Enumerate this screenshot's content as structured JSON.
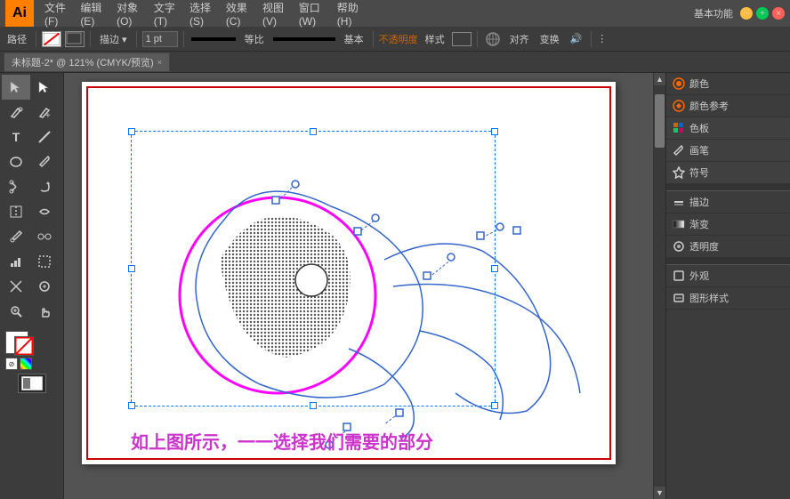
{
  "app": {
    "logo": "Ai",
    "title": "未标题-2* @ 121% (CMYK/预览)"
  },
  "menu": {
    "items": [
      "文件(F)",
      "编辑(E)",
      "对象(O)",
      "文字(T)",
      "选择(S)",
      "效果(C)",
      "视图(V)",
      "窗口(W)",
      "帮助(H)"
    ]
  },
  "toolbar": {
    "path_label": "路径",
    "stroke_label": "描边",
    "stroke_size": "1 pt",
    "equal_label": "等比",
    "basic_label": "基本",
    "opacity_label": "不透明度",
    "style_label": "样式",
    "align_label": "对齐",
    "transform_label": "变换",
    "mode_label": "基本功能"
  },
  "tab": {
    "title": "未标题-2* @ 121% (CMYK/预览)",
    "close": "×"
  },
  "canvas": {
    "caption": "如上图所示，一一选择我们需要的部分"
  },
  "right_panel": {
    "items": [
      {
        "icon": "🎨",
        "label": "颜色",
        "expandable": false
      },
      {
        "icon": "🎨",
        "label": "颜色参考",
        "expandable": false
      },
      {
        "icon": "⊞",
        "label": "色板",
        "expandable": false
      },
      {
        "icon": "✏️",
        "label": "画笔",
        "expandable": false
      },
      {
        "icon": "✦",
        "label": "符号",
        "expandable": false
      },
      {
        "icon": "—",
        "label": "描边",
        "expandable": false
      },
      {
        "icon": "◫",
        "label": "渐变",
        "expandable": false
      },
      {
        "icon": "◎",
        "label": "透明度",
        "expandable": false
      },
      {
        "icon": "◻",
        "label": "外观",
        "expandable": false
      },
      {
        "icon": "▭",
        "label": "图形样式",
        "expandable": false
      }
    ]
  },
  "tools": {
    "rows": [
      [
        "▶",
        "◻"
      ],
      [
        "✎",
        "⊕"
      ],
      [
        "T",
        "◈"
      ],
      [
        "◯",
        "✦"
      ],
      [
        "✂",
        "◆"
      ],
      [
        "⬚",
        "✱"
      ],
      [
        "⊗",
        "◉"
      ],
      [
        "↕",
        "↺"
      ],
      [
        "▤",
        "⧭"
      ],
      [
        "🔍",
        "✋"
      ]
    ]
  },
  "colors": {
    "foreground": "#ffffff",
    "background": "#000000",
    "stroke": "#ff0000"
  }
}
